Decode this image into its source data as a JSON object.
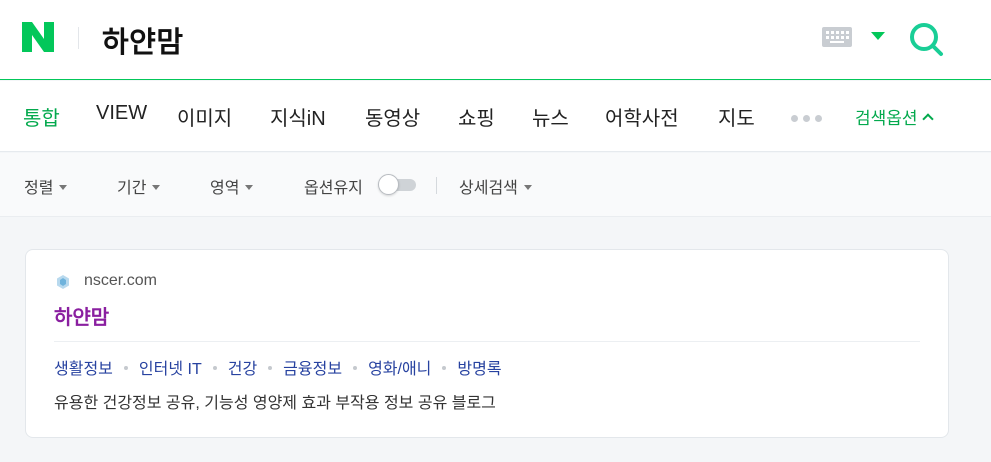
{
  "header": {
    "logo_letter": "N",
    "query": "하얀맘",
    "brand_color": "#03c75a",
    "keyboard_icon": "keyboard-icon",
    "search_icon": "search-icon"
  },
  "tabs": {
    "items": [
      "통합",
      "VIEW",
      "이미지",
      "지식iN",
      "동영상",
      "쇼핑",
      "뉴스",
      "어학사전",
      "지도"
    ],
    "active": "통합",
    "options_label": "검색옵션"
  },
  "filters": {
    "sort": "정렬",
    "period": "기간",
    "area": "영역",
    "keep_options": "옵션유지",
    "keep_options_on": false,
    "advanced": "상세검색"
  },
  "result": {
    "site": "nscer.com",
    "title": "하얀맘",
    "sublinks": [
      "생활정보",
      "인터넷 IT",
      "건강",
      "금융정보",
      "영화/애니",
      "방명록"
    ],
    "description": "유용한 건강정보 공유, 기능성 영양제 효과 부작용 정보 공유 블로그",
    "title_color": "#8a1fa0",
    "link_color": "#2742a0"
  }
}
